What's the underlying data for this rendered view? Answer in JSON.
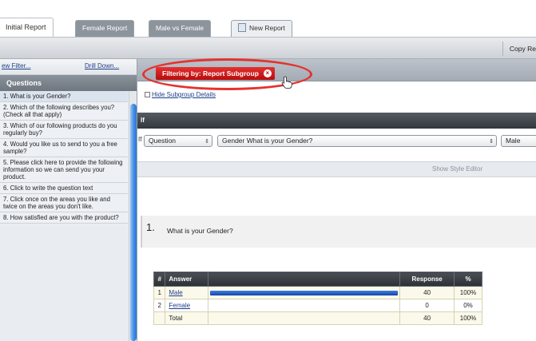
{
  "tabs": [
    {
      "label": "Initial Report"
    },
    {
      "label": "Female Report"
    },
    {
      "label": "Male vs Female"
    },
    {
      "label": "New Report"
    }
  ],
  "toolbar": {
    "copy_report": "Copy Re"
  },
  "sidebar": {
    "links": [
      "ew Filter...",
      "Drill Down..."
    ],
    "header": "Questions",
    "items": [
      {
        "label": "1. What is your Gender?"
      },
      {
        "label": "2. Which of the following describes you? (Check all that apply)"
      },
      {
        "label": "3. Which of our following products do you regularly buy?"
      },
      {
        "label": "4. Would you like us to send to you a free sample?"
      },
      {
        "label": "5. Please click here to provide the following information so we can send you your product."
      },
      {
        "label": "6. Click to write the question text"
      },
      {
        "label": "7. Click once on the areas you like and twice on the areas you don't like."
      },
      {
        "label": "8. How satisfied are you with the product?"
      }
    ]
  },
  "filter": {
    "label": "Filtering by: Report Subgroup",
    "close_icon": "x-circle-icon"
  },
  "subgroup": {
    "hide_details": "Hide Subgroup Details"
  },
  "dark_strip": {
    "label": "If"
  },
  "filter_row": {
    "prefix": "If",
    "field_select": "Question",
    "question_select": "Gender What is your Gender?",
    "value_select": "Male"
  },
  "style_editor": {
    "label": "Show Style Editor"
  },
  "question": {
    "number": "1.",
    "title": "What is your Gender?"
  },
  "results": {
    "headers": [
      "#",
      "Answer",
      "",
      "Response",
      "%"
    ],
    "rows": [
      {
        "idx": "1",
        "answer": "Male",
        "response": "40",
        "pct": "100%",
        "fraction": 1.0
      },
      {
        "idx": "2",
        "answer": "Female",
        "response": "0",
        "pct": "0%",
        "fraction": 0.0
      }
    ],
    "total": {
      "label": "Total",
      "response": "40",
      "pct": "100%"
    }
  },
  "colors": {
    "accent_red": "#e4332f",
    "bar_blue": "#1446a8"
  }
}
